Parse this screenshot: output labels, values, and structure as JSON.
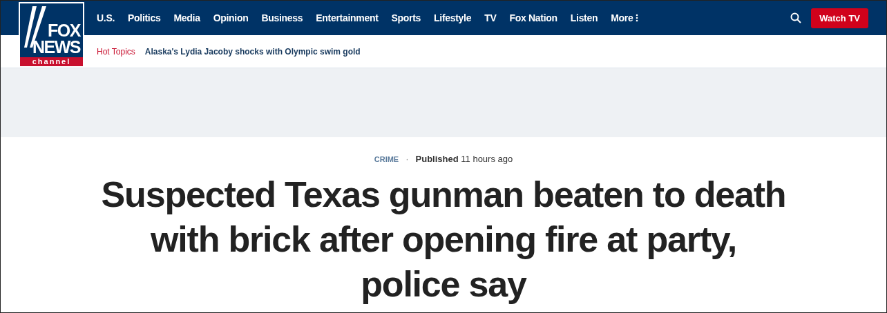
{
  "logo": {
    "top": "FOX",
    "middle": "NEWS",
    "bottom": "channel"
  },
  "nav": [
    {
      "label": "U.S."
    },
    {
      "label": "Politics"
    },
    {
      "label": "Media"
    },
    {
      "label": "Opinion"
    },
    {
      "label": "Business"
    },
    {
      "label": "Entertainment"
    },
    {
      "label": "Sports"
    },
    {
      "label": "Lifestyle"
    },
    {
      "label": "TV"
    },
    {
      "label": "Fox Nation"
    },
    {
      "label": "Listen"
    },
    {
      "label": "More",
      "kind": "menu"
    }
  ],
  "watch_button": "Watch TV",
  "hot_topics": {
    "label": "Hot Topics",
    "items": [
      "Alaska's Lydia Jacoby shocks with Olympic swim gold"
    ]
  },
  "article": {
    "category": "CRIME",
    "separator": "·",
    "published_label": "Published",
    "published_time": "11 hours ago",
    "headline": "Suspected Texas gunman beaten to death with brick after opening fire at party, police say"
  }
}
